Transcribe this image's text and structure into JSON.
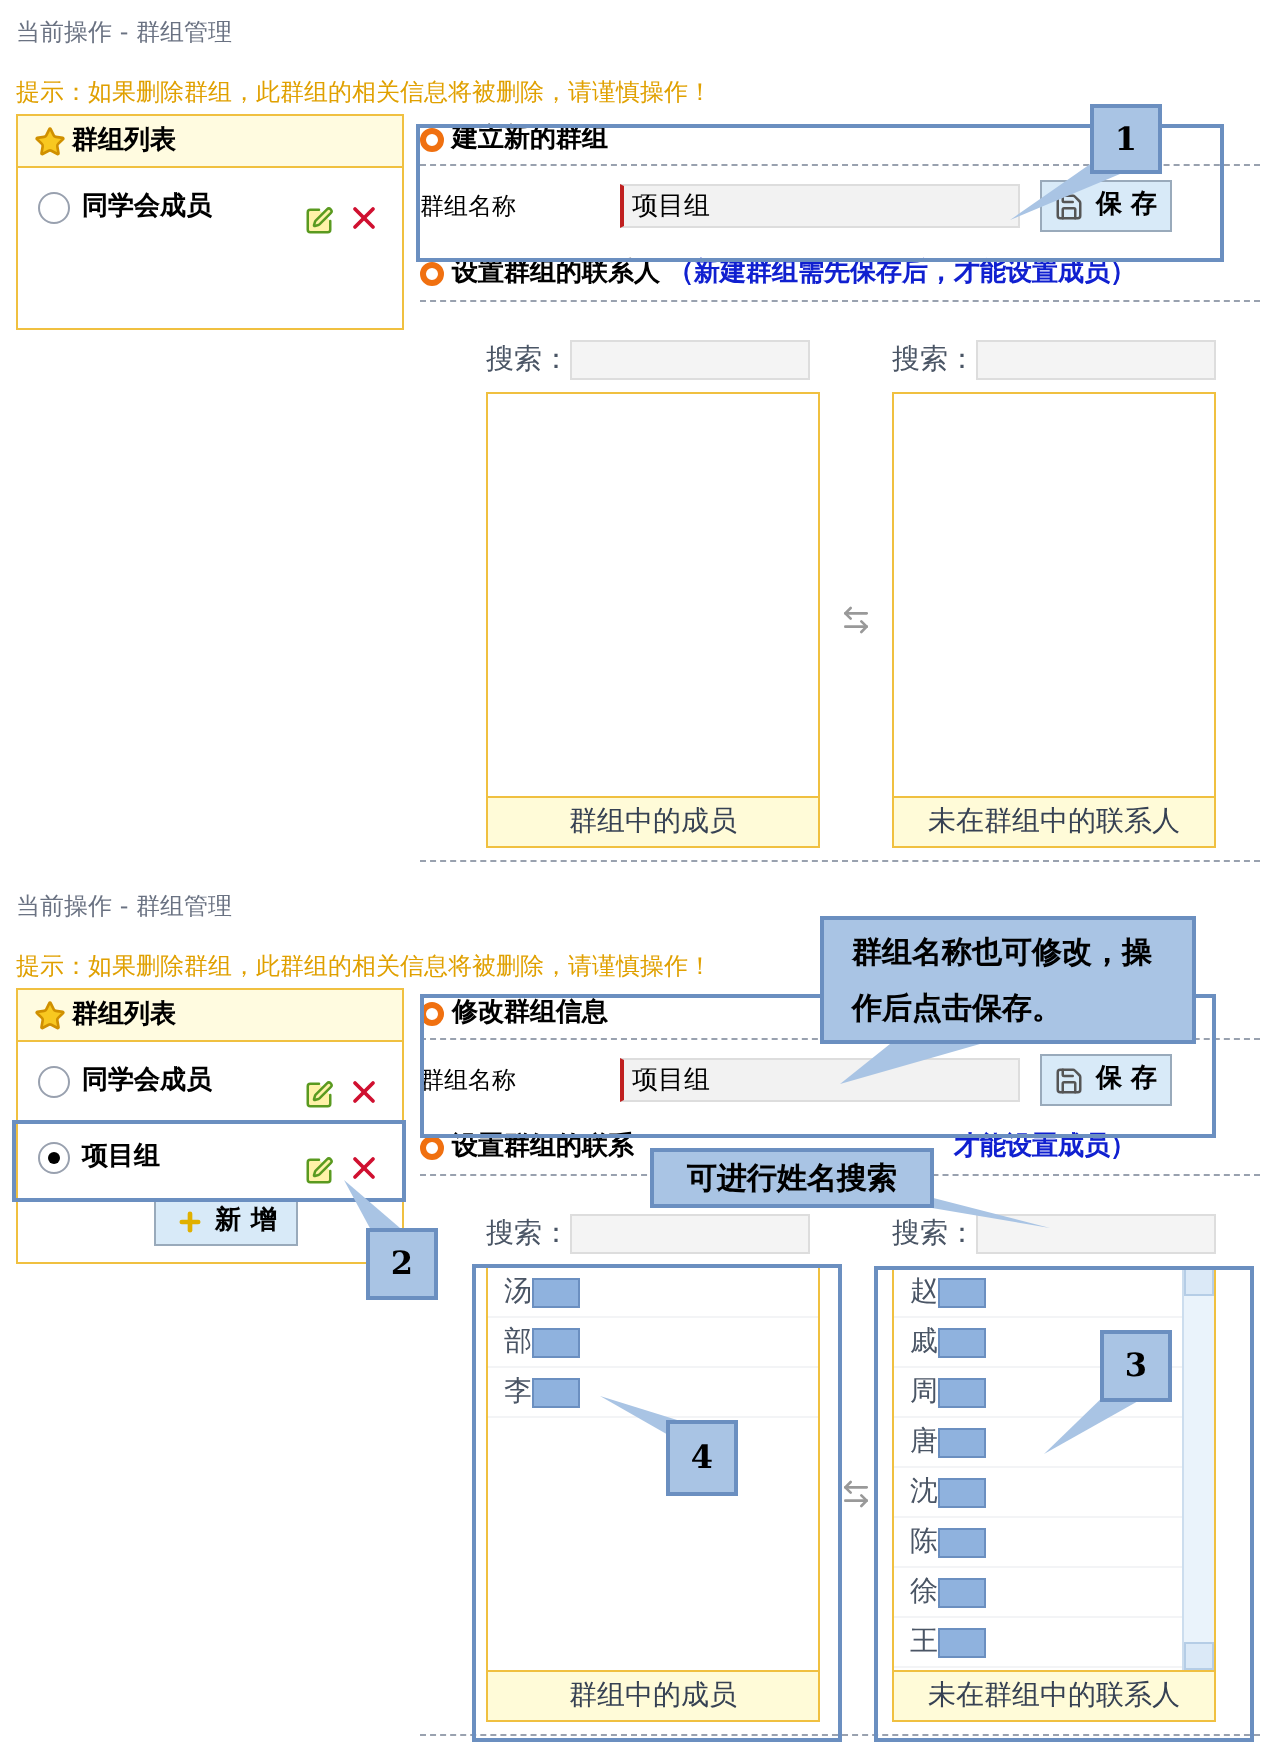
{
  "screens": [
    {
      "breadcrumb": "当前操作 - 群组管理",
      "tip": "提示：如果删除群组，此群组的相关信息将被删除，请谨慎操作！",
      "group_list": {
        "title": "群组列表",
        "items": [
          {
            "name": "同学会成员",
            "selected": false
          }
        ]
      },
      "form": {
        "title": "建立新的群组",
        "label": "群组名称",
        "value": "项目组",
        "save_button": "保 存"
      },
      "members": {
        "title": "设置群组的联系人",
        "note": "（新建群组需先保存后，才能设置成员）",
        "search_label_left": "搜索：",
        "search_label_right": "搜索：",
        "left_list": {
          "caption": "群组中的成员"
        },
        "right_list": {
          "caption": "未在群组中的联系人"
        }
      }
    },
    {
      "breadcrumb": "当前操作 - 群组管理",
      "tip": "提示：如果删除群组，此群组的相关信息将被删除，请谨慎操作！",
      "group_list": {
        "title": "群组列表",
        "items": [
          {
            "name": "同学会成员",
            "selected": false
          },
          {
            "name": "项目组",
            "selected": true
          }
        ],
        "add_button": "新 增"
      },
      "form": {
        "title": "修改群组信息",
        "label": "群组名称",
        "value": "项目组",
        "save_button": "保 存"
      },
      "members": {
        "title": "设置群组的联系",
        "note": "才能设置成员）",
        "search_label_left": "搜索：",
        "search_label_right": "搜索：",
        "left_list": {
          "caption": "群组中的成员",
          "items": [
            {
              "name": "汤",
              "redacted": true
            },
            {
              "name": "部",
              "redacted": true
            },
            {
              "name": "李",
              "redacted": true
            }
          ]
        },
        "right_list": {
          "caption": "未在群组中的联系人",
          "items": [
            {
              "name": "赵",
              "redacted": true
            },
            {
              "name": "戚",
              "redacted": true
            },
            {
              "name": "周",
              "redacted": true
            },
            {
              "name": "唐",
              "redacted": true
            },
            {
              "name": "沈",
              "redacted": true
            },
            {
              "name": "陈",
              "redacted": true
            },
            {
              "name": "徐",
              "redacted": true
            },
            {
              "name": "王",
              "redacted": true
            }
          ]
        }
      }
    }
  ],
  "annotations": [
    {
      "text": "1"
    },
    {
      "text": "群组名称也可修改，操作后点击保存。"
    },
    {
      "text": "可进行姓名搜索"
    },
    {
      "text": "2"
    },
    {
      "text": "4"
    },
    {
      "text": "3"
    }
  ]
}
